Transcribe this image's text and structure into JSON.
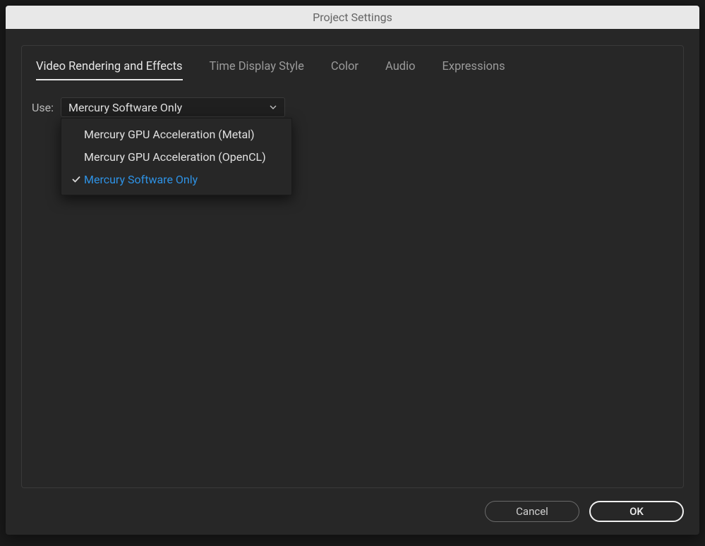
{
  "dialog": {
    "title": "Project Settings"
  },
  "tabs": [
    {
      "label": "Video Rendering and Effects",
      "active": true
    },
    {
      "label": "Time Display Style",
      "active": false
    },
    {
      "label": "Color",
      "active": false
    },
    {
      "label": "Audio",
      "active": false
    },
    {
      "label": "Expressions",
      "active": false
    }
  ],
  "content": {
    "use_label": "Use:",
    "select": {
      "value": "Mercury Software Only",
      "options": [
        {
          "label": "Mercury GPU Acceleration (Metal)",
          "selected": false
        },
        {
          "label": "Mercury GPU Acceleration (OpenCL)",
          "selected": false
        },
        {
          "label": "Mercury Software Only",
          "selected": true
        }
      ]
    }
  },
  "buttons": {
    "cancel": "Cancel",
    "ok": "OK"
  }
}
